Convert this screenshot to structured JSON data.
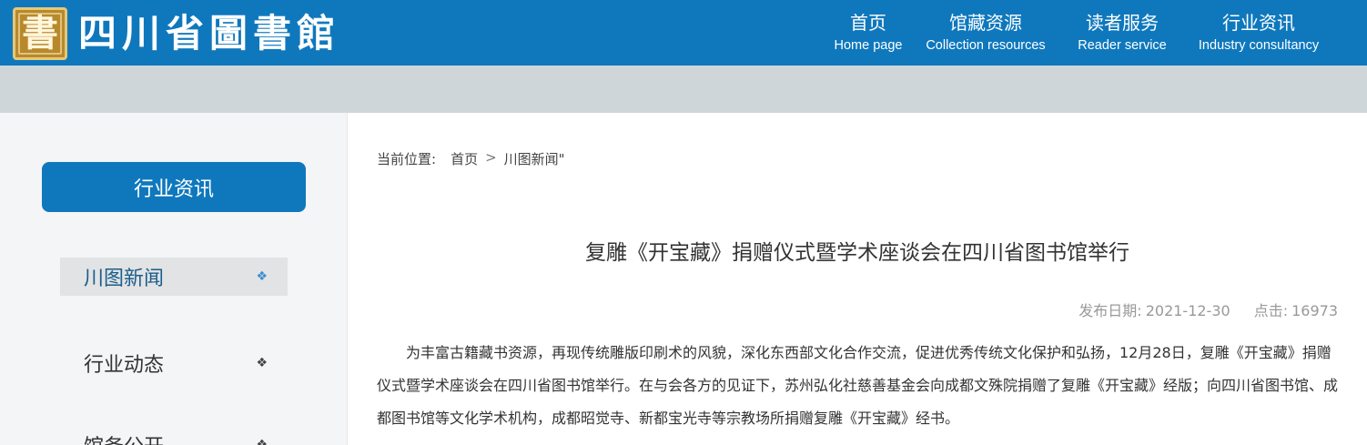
{
  "header": {
    "logo_seal_char": "書",
    "logo_text": "四川省圖書館",
    "nav": [
      {
        "zh": "首页",
        "en": "Home page"
      },
      {
        "zh": "馆藏资源",
        "en": "Collection resources"
      },
      {
        "zh": "读者服务",
        "en": "Reader service"
      },
      {
        "zh": "行业资讯",
        "en": "Industry consultancy"
      }
    ]
  },
  "sidebar": {
    "title": "行业资讯",
    "items": [
      {
        "label": "川图新闻",
        "marker": "❖",
        "active": true
      },
      {
        "label": "行业动态",
        "marker": "❖",
        "active": false
      },
      {
        "label": "馆务公开",
        "marker": "❖",
        "active": false
      }
    ]
  },
  "breadcrumb": {
    "label": "当前位置:",
    "items": [
      "首页",
      "川图新闻\""
    ],
    "separator": ">"
  },
  "article": {
    "title": "复雕《开宝藏》捐赠仪式暨学术座谈会在四川省图书馆举行",
    "date_label": "发布日期:",
    "date": "2021-12-30",
    "views_label": "点击:",
    "views": "16973",
    "body": "为丰富古籍藏书资源，再现传统雕版印刷术的风貌，深化东西部文化合作交流，促进优秀传统文化保护和弘扬，12月28日，复雕《开宝藏》捐赠仪式暨学术座谈会在四川省图书馆举行。在与会各方的见证下，苏州弘化社慈善基金会向成都文殊院捐赠了复雕《开宝藏》经版；向四川省图书馆、成都图书馆等文化学术机构，成都昭觉寺、新都宝光寺等宗教场所捐赠复雕《开宝藏》经书。"
  },
  "colors": {
    "brand_blue": "#0f78bd",
    "subbar_gray": "#cfd6d9",
    "sidebar_bg": "#f4f5f6",
    "active_item_bg": "#e2e3e4"
  }
}
